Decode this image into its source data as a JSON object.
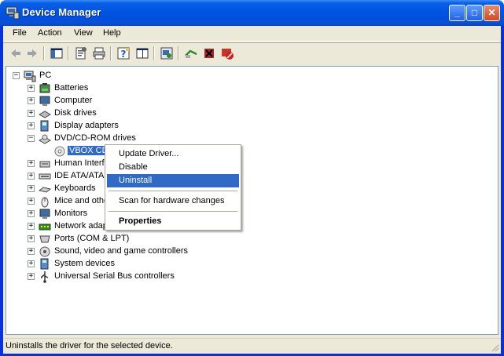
{
  "window": {
    "title": "Device Manager",
    "icon": "device-manager-icon"
  },
  "titlebar_buttons": {
    "minimize": "_",
    "maximize": "□",
    "close": "✕"
  },
  "menu": [
    "File",
    "Action",
    "View",
    "Help"
  ],
  "toolbar": [
    "back-icon",
    "forward-icon",
    "show-hide-console-tree-icon",
    "properties-icon",
    "print-icon",
    "help-icon",
    "view-icon",
    "refresh-icon",
    "update-driver-icon",
    "uninstall-icon",
    "disable-icon"
  ],
  "tree": {
    "root": {
      "label": "PC",
      "expander": "−"
    },
    "categories": [
      {
        "label": "Batteries",
        "expander": "+",
        "icon": "battery-icon"
      },
      {
        "label": "Computer",
        "expander": "+",
        "icon": "computer-icon"
      },
      {
        "label": "Disk drives",
        "expander": "+",
        "icon": "disk-drive-icon"
      },
      {
        "label": "Display adapters",
        "expander": "+",
        "icon": "display-adapter-icon"
      },
      {
        "label": "DVD/CD-ROM drives",
        "expander": "−",
        "icon": "cdrom-icon"
      },
      {
        "label": "Human Interf",
        "expander": "+",
        "icon": "hid-icon"
      },
      {
        "label": "IDE ATA/ATA",
        "expander": "+",
        "icon": "ide-icon"
      },
      {
        "label": "Keyboards",
        "expander": "+",
        "icon": "keyboard-icon"
      },
      {
        "label": "Mice and othe",
        "expander": "+",
        "icon": "mouse-icon"
      },
      {
        "label": "Monitors",
        "expander": "+",
        "icon": "monitor-icon"
      },
      {
        "label": "Network adap",
        "expander": "+",
        "icon": "network-adapter-icon"
      },
      {
        "label": "Ports (COM & LPT)",
        "expander": "+",
        "icon": "port-icon"
      },
      {
        "label": "Sound, video and game controllers",
        "expander": "+",
        "icon": "sound-icon"
      },
      {
        "label": "System devices",
        "expander": "+",
        "icon": "system-devices-icon"
      },
      {
        "label": "Universal Serial Bus controllers",
        "expander": "+",
        "icon": "usb-icon"
      }
    ],
    "selected_child": {
      "label": "VBOX CD-",
      "icon": "cd-disc-icon"
    }
  },
  "context_menu": {
    "items": [
      {
        "label": "Update Driver..."
      },
      {
        "label": "Disable"
      },
      {
        "label": "Uninstall",
        "highlighted": true
      },
      {
        "label": "Scan for hardware changes"
      },
      {
        "label": "Properties",
        "bold": true
      }
    ]
  },
  "status_bar": {
    "text": "Uninstalls the driver for the selected device."
  },
  "colors": {
    "titlebar": "#0054e3",
    "selection": "#316ac5",
    "chrome": "#ece9d8"
  }
}
